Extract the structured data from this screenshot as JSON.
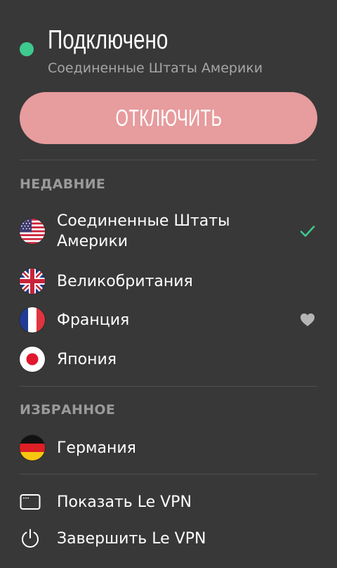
{
  "status": {
    "title": "Подключено",
    "subtitle": "Соединенные Штаты Америки",
    "indicator_color": "#3ec98e"
  },
  "disconnect_button": {
    "label": "ОТКЛЮЧИТЬ",
    "color": "#e79c9e"
  },
  "recent": {
    "header": "НЕДАВНИЕ",
    "items": [
      {
        "label": "Соединенные Штаты Америки",
        "flag": "usa-flag-icon",
        "trailing": "checkmark-icon"
      },
      {
        "label": "Великобритания",
        "flag": "uk-flag-icon",
        "trailing": ""
      },
      {
        "label": "Франция",
        "flag": "france-flag-icon",
        "trailing": "heart-icon"
      },
      {
        "label": "Япония",
        "flag": "japan-flag-icon",
        "trailing": ""
      }
    ]
  },
  "favorites": {
    "header": "ИЗБРАННОЕ",
    "items": [
      {
        "label": "Германия",
        "flag": "germany-flag-icon"
      }
    ]
  },
  "actions": {
    "show_label": "Показать Le VPN",
    "show_icon": "window-icon",
    "quit_label": "Завершить Le VPN",
    "quit_icon": "power-icon"
  },
  "colors": {
    "background": "#383838",
    "accent_green": "#3ec98e",
    "muted_text": "#9a9a9a"
  }
}
